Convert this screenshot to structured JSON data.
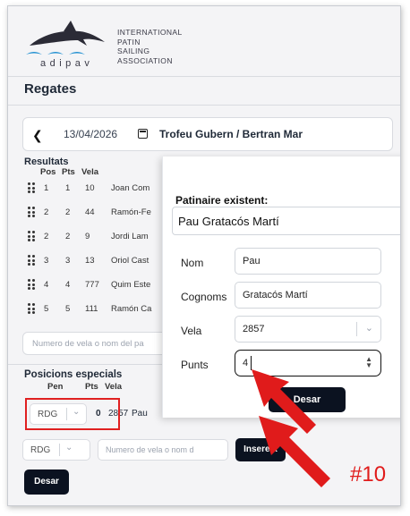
{
  "org": {
    "lines": [
      "INTERNATIONAL",
      "PATIN",
      "SAILING",
      "ASSOCIATION"
    ],
    "wordmark": "adipav"
  },
  "page_title": "Regates",
  "date_bar": {
    "back_icon": "chevron-left-icon",
    "date": "13/04/2026",
    "calendar_icon": "calendar-icon",
    "event_name": "Trofeu Gubern / Bertran Mar"
  },
  "results": {
    "title": "Resultats",
    "columns": [
      "Pos",
      "Pts",
      "Vela"
    ],
    "rows": [
      {
        "pos": "1",
        "pts": "1",
        "vela": "10",
        "name": "Joan Com"
      },
      {
        "pos": "2",
        "pts": "2",
        "vela": "44",
        "name": "Ramón-Fe"
      },
      {
        "pos": "2",
        "pts": "2",
        "vela": "9",
        "name": "Jordi Lam"
      },
      {
        "pos": "3",
        "pts": "3",
        "vela": "13",
        "name": "Oriol Cast"
      },
      {
        "pos": "4",
        "pts": "4",
        "vela": "777",
        "name": "Quim Este"
      },
      {
        "pos": "5",
        "pts": "5",
        "vela": "111",
        "name": "Ramón Ca"
      }
    ],
    "search_placeholder": "Numero de vela o nom del pa"
  },
  "special": {
    "title": "Posicions especials",
    "columns": [
      "Pen",
      "Pts",
      "Vela"
    ],
    "row": {
      "pen": "RDG",
      "pts": "0",
      "vela": "2857",
      "name": "Pau"
    },
    "add_row": {
      "pen": "RDG",
      "placeholder": "Numero de vela o nom d",
      "insert_label": "Insereix"
    },
    "save_label": "Desar"
  },
  "modal": {
    "existing_label": "Patinaire existent:",
    "selected": "Pau Gratacós Martí",
    "fields": {
      "nom": {
        "label": "Nom",
        "value": "Pau"
      },
      "cognoms": {
        "label": "Cognoms",
        "value": "Gratacós Martí"
      },
      "vela": {
        "label": "Vela",
        "value": "2857"
      },
      "punts": {
        "label": "Punts",
        "value": "4"
      }
    },
    "save_label": "Desar"
  },
  "annotation": {
    "step": "#10",
    "color": "#e01b1b"
  }
}
